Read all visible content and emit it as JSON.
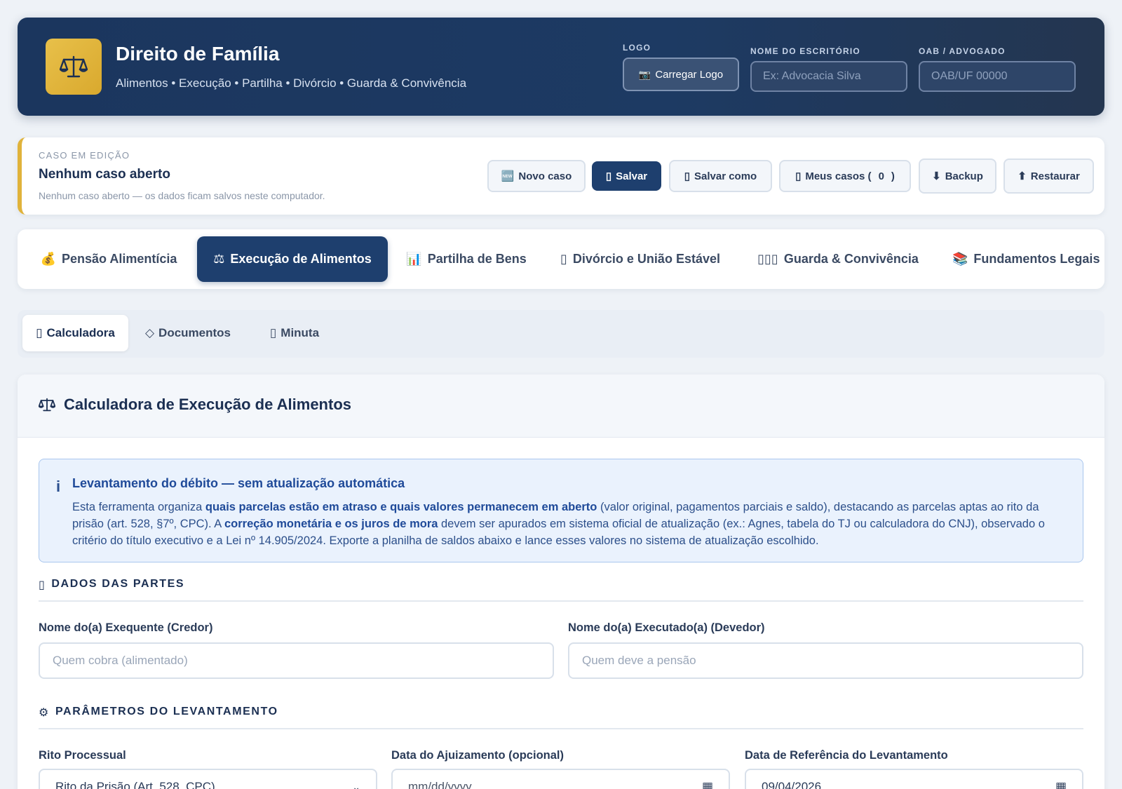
{
  "header": {
    "title": "Direito de Família",
    "subtitle": "Alimentos • Execução • Partilha • Divórcio • Guarda & Convivência",
    "logo_label": "LOGO",
    "logo_button": "Carregar Logo",
    "office_label": "NOME DO ESCRITÓRIO",
    "office_placeholder": "Ex: Advocacia Silva",
    "oab_label": "OAB / ADVOGADO",
    "oab_placeholder": "OAB/UF 00000"
  },
  "case": {
    "kicker": "CASO EM EDIÇÃO",
    "title": "Nenhum caso aberto",
    "note": "Nenhum caso aberto — os dados ficam salvos neste computador.",
    "buttons": {
      "new": "Novo caso",
      "save": "Salvar",
      "save_as": "Salvar como",
      "my_cases": "Meus casos (",
      "my_cases_count": "0",
      "my_cases_close": ")",
      "backup": "Backup",
      "restore": "Restaurar"
    }
  },
  "tabs": [
    {
      "icon": "💰",
      "label": "Pensão Alimentícia"
    },
    {
      "icon": "⚖",
      "label": "Execução de Alimentos"
    },
    {
      "icon": "📊",
      "label": "Partilha de Bens"
    },
    {
      "icon": "▯",
      "label": "Divórcio e União Estável"
    },
    {
      "icon": "▯▯▯",
      "label": "Guarda & Convivência"
    },
    {
      "icon": "📚",
      "label": "Fundamentos Legais"
    }
  ],
  "subtabs": [
    {
      "icon": "▯",
      "label": "Calculadora"
    },
    {
      "icon": "◇",
      "label": "Documentos"
    },
    {
      "icon": "▯",
      "label": "Minuta"
    }
  ],
  "card": {
    "title": "Calculadora de Execução de Alimentos",
    "info": {
      "icon": "i",
      "title": "Levantamento do débito — sem atualização automática",
      "p1": "Esta ferramenta organiza ",
      "b1": "quais parcelas estão em atraso e quais valores permanecem em aberto",
      "p2": " (valor original, pagamentos parciais e saldo), destacando as parcelas aptas ao rito da prisão (art. 528, §7º, CPC). A ",
      "b2": "correção monetária e os juros de mora",
      "p3": " devem ser apurados em sistema oficial de atualização (ex.: Agnes, tabela do TJ ou calculadora do CNJ), observado o critério do título executivo e a Lei nº 14.905/2024. Exporte a planilha de saldos abaixo e lance esses valores no sistema de atualização escolhido."
    },
    "section_parties": {
      "icon": "▯",
      "label": "DADOS DAS PARTES"
    },
    "creditor_label": "Nome do(a) Exequente (Credor)",
    "creditor_placeholder": "Quem cobra (alimentado)",
    "debtor_label": "Nome do(a) Executado(a) (Devedor)",
    "debtor_placeholder": "Quem deve a pensão",
    "section_params": {
      "icon": "⚙",
      "label": "PARÂMETROS DO LEVANTAMENTO"
    },
    "rito_label": "Rito Processual",
    "rito_value": "Rito da Prisão (Art. 528, CPC)",
    "filing_label": "Data do Ajuizamento (opcional)",
    "filing_value": "mm/dd/yyyy",
    "ref_label": "Data de Referência do Levantamento",
    "ref_value": "09/04/2026"
  },
  "colors": {
    "primary": "#1e3f6e",
    "accent": "#e0b33b",
    "info_bg": "#eaf2fd"
  }
}
